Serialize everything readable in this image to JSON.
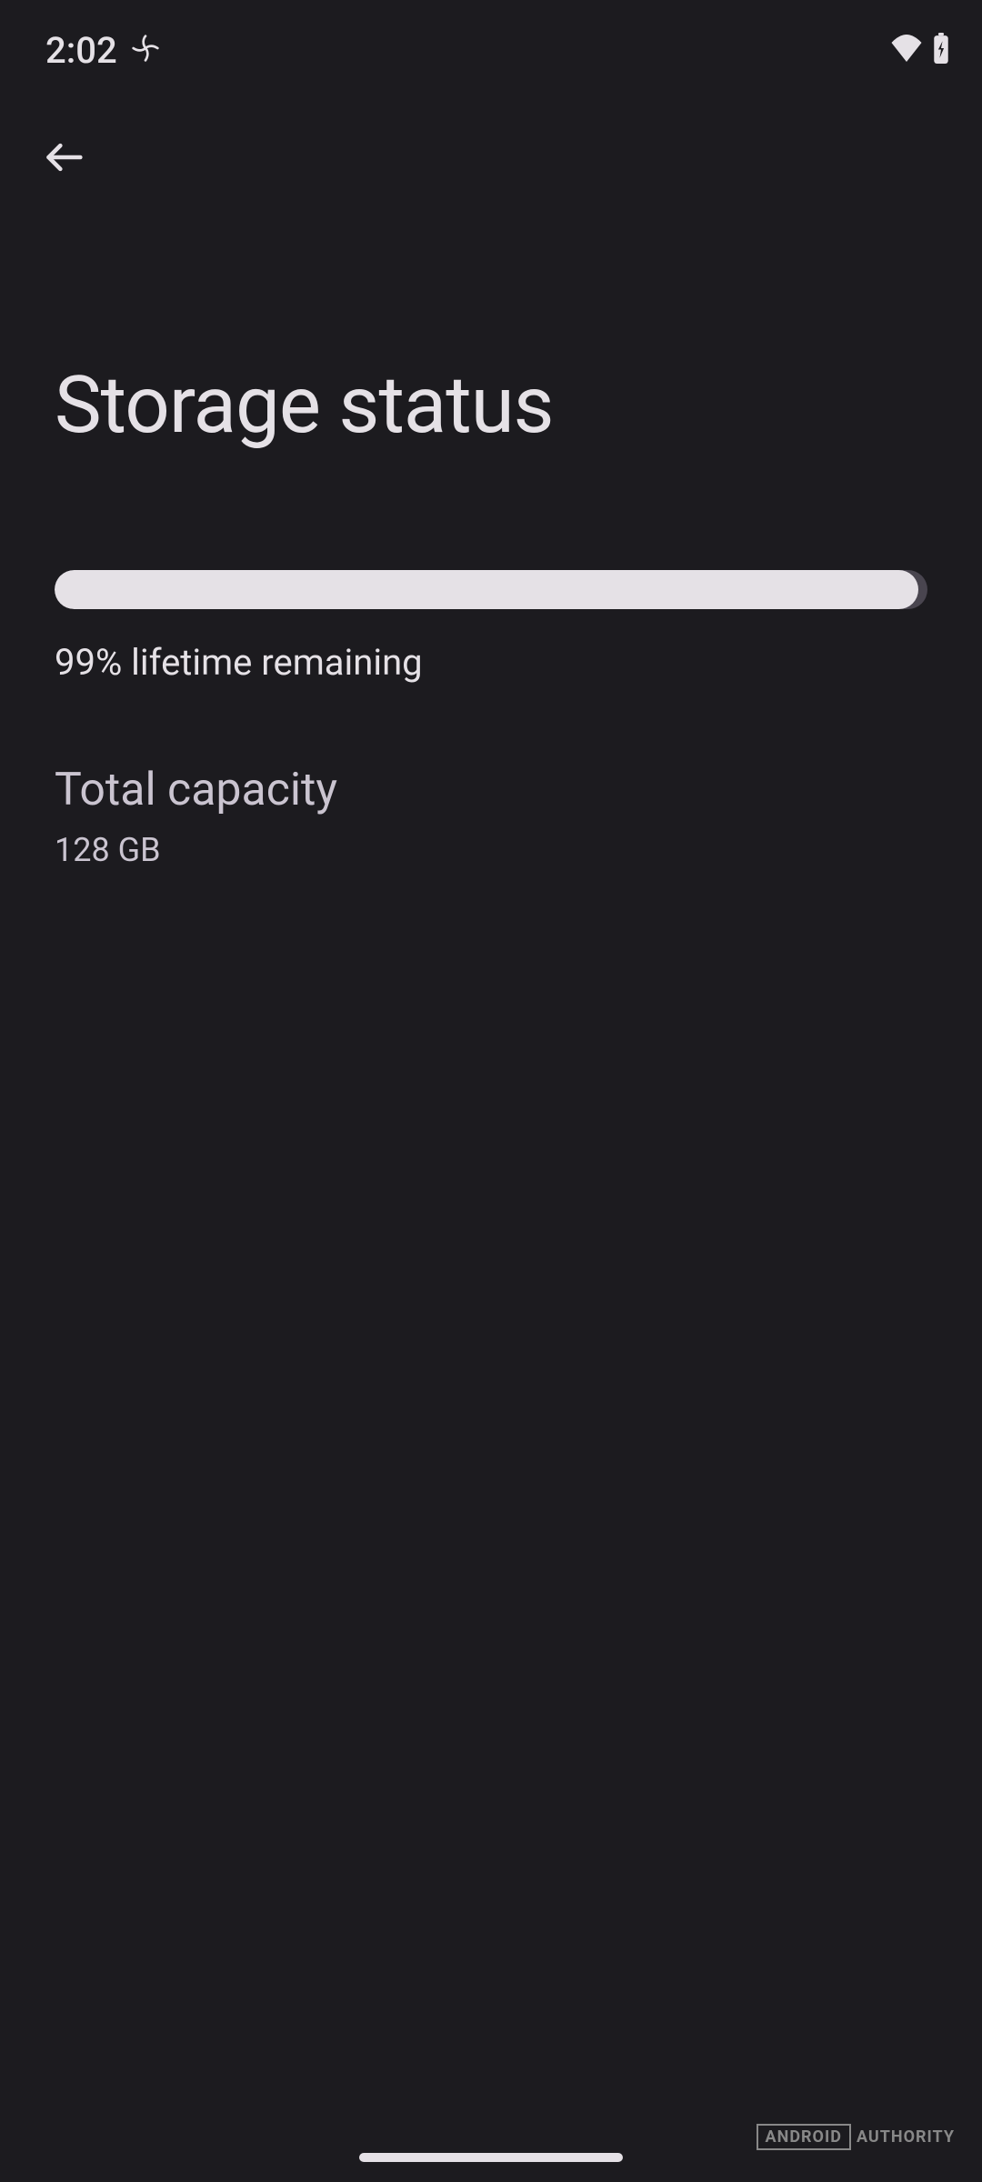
{
  "statusBar": {
    "time": "2:02"
  },
  "page": {
    "title": "Storage status"
  },
  "progress": {
    "percentage": 99,
    "label": "99% lifetime remaining"
  },
  "capacity": {
    "label": "Total capacity",
    "value": "128 GB"
  },
  "watermark": {
    "box": "ANDROID",
    "text": "AUTHORITY"
  }
}
